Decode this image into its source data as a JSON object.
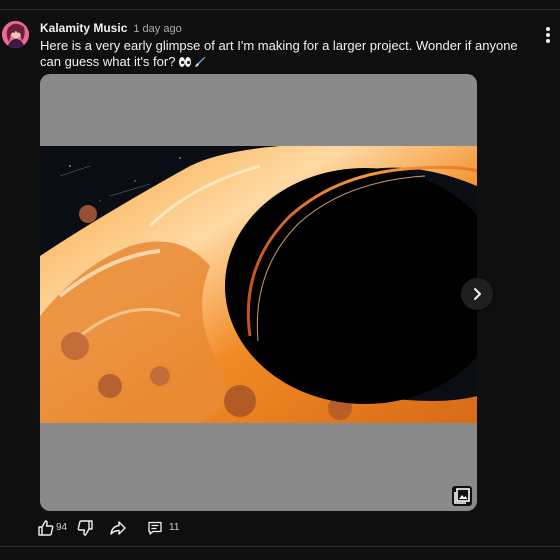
{
  "post": {
    "author": "Kalamity Music",
    "time": "1 day ago",
    "text": "Here is a very early glimpse of art I'm making for a larger project. Wonder if anyone can guess what it's for?",
    "emojis": [
      "eyes-emoji",
      "paintbrush-emoji"
    ]
  },
  "media": {
    "image_subject": "black hole with orange accretion disk artwork",
    "icons": [
      "gallery-icon",
      "chevron-right-icon"
    ]
  },
  "actions": {
    "like_count": "94",
    "comment_count": "11",
    "icons": [
      "thumbs-up-icon",
      "thumbs-down-icon",
      "share-icon",
      "comment-icon",
      "more-vert-icon"
    ]
  },
  "colors": {
    "background": "#0f0f0f",
    "media_background": "#8a8a8a",
    "accent_orange": "#f08a24",
    "text_primary": "#f1f1f1",
    "text_secondary": "#aaaaaa"
  }
}
